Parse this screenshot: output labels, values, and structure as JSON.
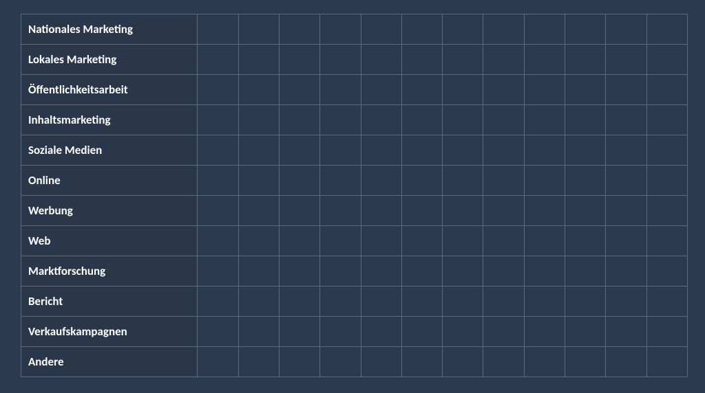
{
  "table": {
    "rows": [
      {
        "label": "Nationales Marketing"
      },
      {
        "label": "Lokales Marketing"
      },
      {
        "label": "Öffentlichkeitsarbeit"
      },
      {
        "label": "Inhaltsmarketing"
      },
      {
        "label": "Soziale Medien"
      },
      {
        "label": "Online"
      },
      {
        "label": "Werbung"
      },
      {
        "label": "Web"
      },
      {
        "label": "Marktforschung"
      },
      {
        "label": "Bericht"
      },
      {
        "label": "Verkaufskampagnen"
      },
      {
        "label": "Andere"
      }
    ],
    "dataColumns": 12
  }
}
